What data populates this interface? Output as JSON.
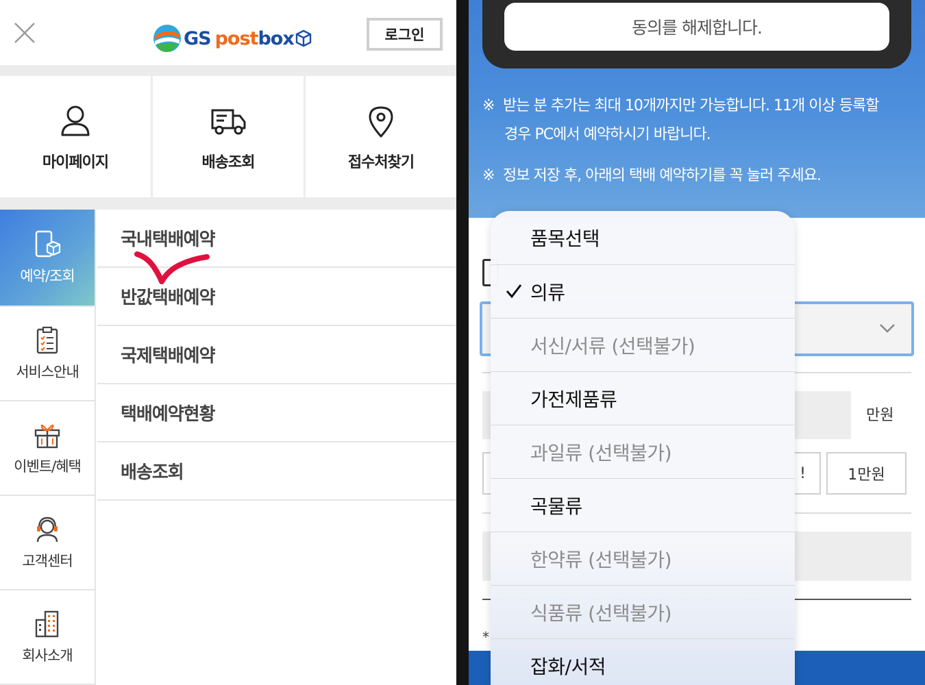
{
  "left": {
    "login_label": "로그인",
    "logo": {
      "gs": "GS",
      "post": "post",
      "box": "box"
    },
    "quick_links": [
      {
        "label": "마이페이지",
        "icon": "user-icon"
      },
      {
        "label": "배송조회",
        "icon": "truck-icon"
      },
      {
        "label": "접수처찾기",
        "icon": "map-pin-icon"
      }
    ],
    "side_menu": [
      {
        "label": "예약/조회",
        "icon": "phone-box-icon",
        "active": true
      },
      {
        "label": "서비스안내",
        "icon": "clipboard-icon"
      },
      {
        "label": "이벤트/혜택",
        "icon": "gift-icon"
      },
      {
        "label": "고객센터",
        "icon": "headset-icon"
      },
      {
        "label": "회사소개",
        "icon": "building-icon"
      }
    ],
    "sub_menu": [
      "국내택배예약",
      "반값택배예약",
      "국제택배예약",
      "택배예약현황",
      "배송조회"
    ]
  },
  "right": {
    "revoke_label": "동의를 해제합니다.",
    "notice_mark": "※",
    "notice1_line1": "받는 분 추가는 최대 10개까지만 가능합니다. 11개 이상 등록할",
    "notice1_line2": "경우 PC에서 예약하시기 바랍니다.",
    "notice2": "정보 저장 후, 아래의 택배 예약하기를 꼭 눌러 주세요.",
    "unit_label": "만원",
    "amount_btn_a": "!",
    "amount_btn_b": "1만원",
    "asterisk": "*",
    "dropdown": {
      "options": [
        {
          "label": "품목선택",
          "disabled": false,
          "selected": false
        },
        {
          "label": "의류",
          "disabled": false,
          "selected": true
        },
        {
          "label": "서신/서류 (선택불가)",
          "disabled": true,
          "selected": false
        },
        {
          "label": "가전제품류",
          "disabled": false,
          "selected": false
        },
        {
          "label": "과일류 (선택불가)",
          "disabled": true,
          "selected": false
        },
        {
          "label": "곡물류",
          "disabled": false,
          "selected": false
        },
        {
          "label": "한약류 (선택불가)",
          "disabled": true,
          "selected": false
        },
        {
          "label": "식품류 (선택불가)",
          "disabled": true,
          "selected": false
        },
        {
          "label": "잡화/서적",
          "disabled": false,
          "selected": false
        }
      ]
    }
  },
  "colors": {
    "accent_blue": "#3f7fd6",
    "logo_orange": "#f06b1a",
    "logo_blue": "#1a4fa3",
    "annotation_red": "#e0113f"
  }
}
